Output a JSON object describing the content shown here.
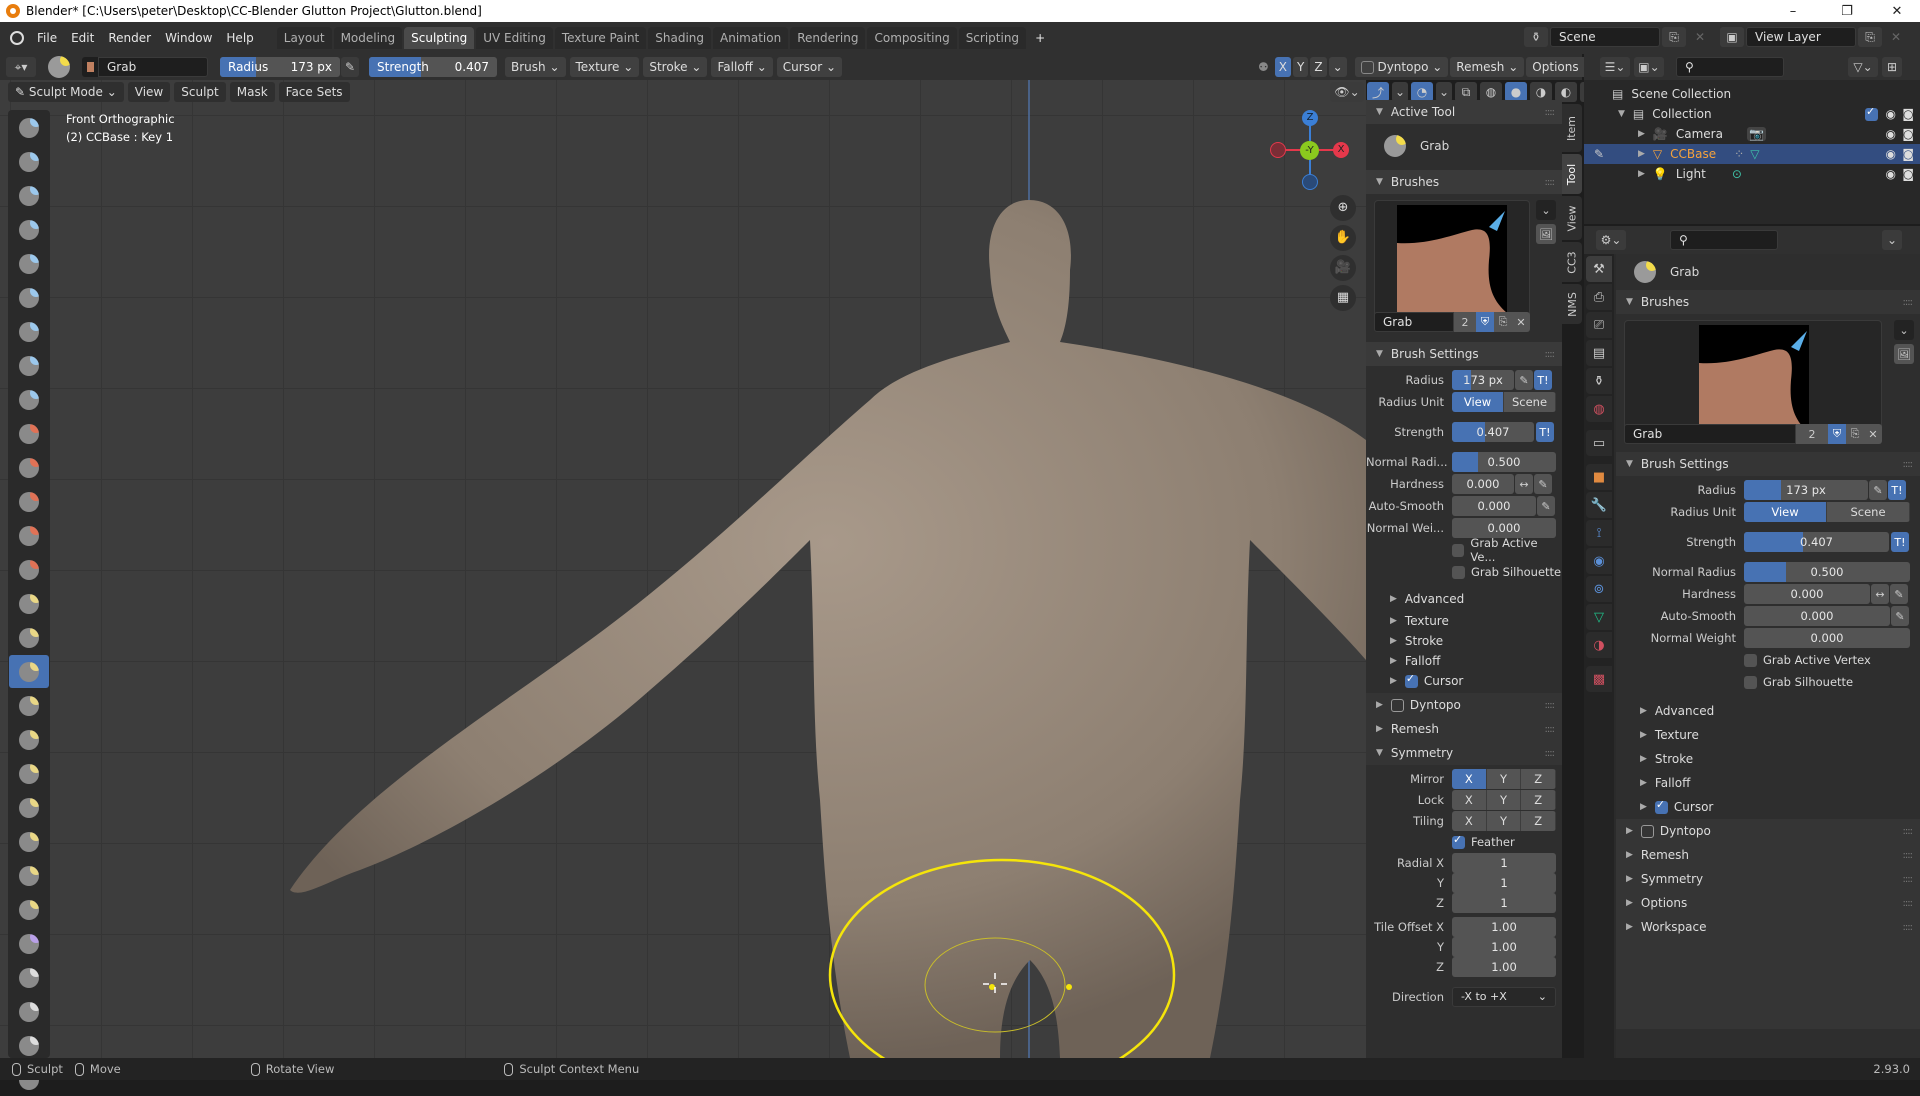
{
  "window": {
    "title": "Blender* [C:\\Users\\peter\\Desktop\\CC-Blender Glutton Project\\Glutton.blend]",
    "controls": [
      "minimize",
      "maximize",
      "close"
    ]
  },
  "menubar": {
    "items": [
      "File",
      "Edit",
      "Render",
      "Window",
      "Help"
    ],
    "workspace_tabs": [
      "Layout",
      "Modeling",
      "Sculpting",
      "UV Editing",
      "Texture Paint",
      "Shading",
      "Animation",
      "Rendering",
      "Compositing",
      "Scripting"
    ],
    "active_workspace": "Sculpting",
    "add_tab": "+",
    "scene": "Scene",
    "view_layer": "View Layer"
  },
  "tool_header": {
    "brush_name": "Grab",
    "radius_label": "Radius",
    "radius_value": "173 px",
    "radius_fraction": 0.3,
    "strength_label": "Strength",
    "strength_value": "0.407",
    "strength_fraction": 0.407,
    "dropdowns": [
      "Brush",
      "Texture",
      "Stroke",
      "Falloff",
      "Cursor"
    ],
    "symmetry_axes": [
      "X",
      "Y",
      "Z"
    ],
    "symmetry_active": "X",
    "dyntopo_label": "Dyntopo",
    "remesh_label": "Remesh",
    "options_label": "Options"
  },
  "viewport_header": {
    "mode": "Sculpt Mode",
    "menus": [
      "View",
      "Sculpt",
      "Mask",
      "Face Sets"
    ]
  },
  "viewport": {
    "view_name": "Front Orthographic",
    "object_info": "(2) CCBase : Key 1",
    "gizmo_axes": {
      "z": "Z",
      "y": "-Y",
      "x": "X"
    },
    "gizmo_colors": {
      "x": "#e5384b",
      "y": "#8bc91e",
      "z": "#3b7fd6"
    }
  },
  "toolbar": {
    "active_tool_index": 16,
    "tools": [
      "draw",
      "draw-sharp",
      "clay",
      "clay-strips",
      "clay-thumb",
      "layer",
      "inflate",
      "blob",
      "crease",
      "smooth",
      "flatten",
      "fill",
      "scrape",
      "multiplane-scrape",
      "pinch",
      "grab",
      "elastic-deform",
      "snake-hook",
      "thumb",
      "pose",
      "nudge",
      "rotate",
      "slide-relax",
      "boundary",
      "cloth",
      "simplify",
      "mask",
      "draw-face-sets",
      "box-mask"
    ]
  },
  "n_panel": {
    "tabs": [
      "Item",
      "Tool",
      "View",
      "CC3",
      "NMS"
    ],
    "active_tab": "Tool",
    "active_tool_header": "Active Tool",
    "active_tool_name": "Grab",
    "brushes_header": "Brushes",
    "brush_name": "Grab",
    "brush_users": "2",
    "brush_settings_header": "Brush Settings",
    "settings": {
      "radius_label": "Radius",
      "radius_value": "173 px",
      "radius_fraction": 0.3,
      "radius_unit_label": "Radius Unit",
      "radius_unit_options": [
        "View",
        "Scene"
      ],
      "radius_unit_active": "View",
      "strength_label": "Strength",
      "strength_value": "0.407",
      "strength_fraction": 0.407,
      "normal_radius_label": "Normal Radi...",
      "normal_radius_value": "0.500",
      "normal_radius_fraction": 0.25,
      "hardness_label": "Hardness",
      "hardness_value": "0.000",
      "autosmooth_label": "Auto-Smooth",
      "autosmooth_value": "0.000",
      "normal_weight_label": "Normal Wei...",
      "normal_weight_value": "0.000",
      "grab_active_vertex_label": "Grab Active Ve...",
      "grab_active_vertex_checked": false,
      "grab_silhouette_label": "Grab Silhouette",
      "grab_silhouette_checked": false
    },
    "subpanels": [
      "Advanced",
      "Texture",
      "Stroke",
      "Falloff"
    ],
    "cursor_label": "Cursor",
    "cursor_checked": true,
    "dyntopo_label": "Dyntopo",
    "dyntopo_checked": false,
    "remesh_label": "Remesh",
    "symmetry_header": "Symmetry",
    "symmetry": {
      "mirror_label": "Mirror",
      "mirror_active": [
        "X"
      ],
      "lock_label": "Lock",
      "tiling_label": "Tiling",
      "axes": [
        "X",
        "Y",
        "Z"
      ],
      "feather_label": "Feather",
      "feather_checked": true,
      "radial_label": "Radial X",
      "radial_values": [
        "1",
        "1",
        "1"
      ],
      "tile_offset_label": "Tile Offset X",
      "tile_offset_values": [
        "1.00",
        "1.00",
        "1.00"
      ],
      "y_label": "Y",
      "z_label": "Z",
      "direction_label": "Direction",
      "direction_value": "-X to +X"
    }
  },
  "outliner": {
    "root": "Scene Collection",
    "collection": "Collection",
    "items": [
      {
        "name": "Camera",
        "color": "#e8a060",
        "selected": false
      },
      {
        "name": "CCBase",
        "color": "#f5a23c",
        "selected": true
      },
      {
        "name": "Light",
        "color": "#e8a060",
        "selected": false
      }
    ]
  },
  "properties": {
    "tool_name": "Grab",
    "brushes_header": "Brushes",
    "brush_name": "Grab",
    "brush_users": "2",
    "brush_settings_header": "Brush Settings",
    "settings": {
      "radius_label": "Radius",
      "radius_value": "173 px",
      "radius_fraction": 0.3,
      "radius_unit_label": "Radius Unit",
      "radius_unit_options": [
        "View",
        "Scene"
      ],
      "strength_label": "Strength",
      "strength_value": "0.407",
      "strength_fraction": 0.407,
      "normal_radius_label": "Normal Radius",
      "normal_radius_value": "0.500",
      "normal_radius_fraction": 0.25,
      "hardness_label": "Hardness",
      "hardness_value": "0.000",
      "autosmooth_label": "Auto-Smooth",
      "autosmooth_value": "0.000",
      "normal_weight_label": "Normal Weight",
      "normal_weight_value": "0.000",
      "grab_active_vertex_label": "Grab Active Vertex",
      "grab_silhouette_label": "Grab Silhouette"
    },
    "subpanels": [
      "Advanced",
      "Texture",
      "Stroke",
      "Falloff"
    ],
    "cursor_label": "Cursor",
    "panels": [
      "Dyntopo",
      "Remesh",
      "Symmetry",
      "Options",
      "Workspace"
    ],
    "tabs": [
      "tool",
      "render",
      "output",
      "view-layer",
      "scene",
      "world",
      "collection",
      "object",
      "modifiers",
      "particles",
      "physics",
      "constraints",
      "data",
      "material",
      "texture"
    ]
  },
  "statusbar": {
    "left_click": "Sculpt",
    "drag": "Move",
    "middle": "Rotate View",
    "right": "Sculpt Context Menu",
    "version": "2.93.0"
  },
  "colors": {
    "accent": "#4772b3",
    "selection": "#334d80",
    "brush_cursor": "#f5e50a",
    "active_object": "#f5a23c"
  }
}
